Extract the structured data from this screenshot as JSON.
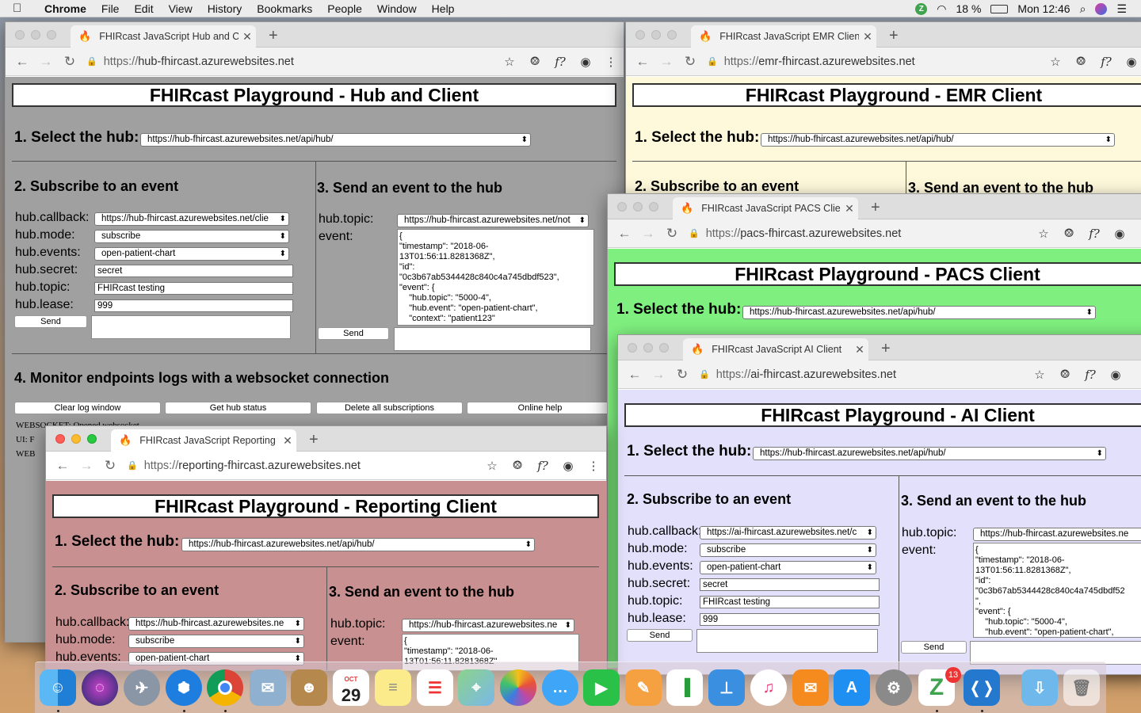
{
  "menubar": {
    "app": "Chrome",
    "items": [
      "File",
      "Edit",
      "View",
      "History",
      "Bookmarks",
      "People",
      "Window",
      "Help"
    ],
    "battery": "18 %",
    "clock": "Mon 12:46",
    "z": "Z"
  },
  "common": {
    "select_hub": "1. Select the hub:",
    "hub_url": "https://hub-fhircast.azurewebsites.net/api/hub/",
    "subscribe_title": "2. Subscribe to an event",
    "send_title": "3. Send an event to the hub",
    "monitor_title": "4. Monitor endpoints logs with a websocket connection",
    "labels": {
      "callback": "hub.callback:",
      "mode": "hub.mode:",
      "events": "hub.events:",
      "secret": "hub.secret:",
      "topic": "hub.topic:",
      "lease": "hub.lease:",
      "event": "event:"
    },
    "mode": "subscribe",
    "events": "open-patient-chart",
    "secret": "secret",
    "topic_val": "FHIRcast testing",
    "lease": "999",
    "send": "Send",
    "event_json": "{\n\"timestamp\": \"2018-06-\n13T01:56:11.8281368Z\",\n\"id\":\n\"0c3b67ab5344428c840c4a745dbdf523\",\n\"event\": {\n    \"hub.topic\": \"5000-4\",\n    \"hub.event\": \"open-patient-chart\",\n    \"context\": \"patient123\""
  },
  "hub": {
    "tab": "FHIRcast JavaScript Hub and C",
    "url_pre": "https://",
    "url": "hub-fhircast.azurewebsites.net",
    "title": "FHIRcast Playground - Hub and Client",
    "callback": "https://hub-fhircast.azurewebsites.net/clie",
    "send_topic": "https://hub-fhircast.azurewebsites.net/not",
    "buttons": [
      "Clear log window",
      "Get hub status",
      "Delete all subscriptions",
      "Online help"
    ],
    "logs": [
      "WEBSOCKET: Opened websocket",
      "UI: F",
      "WEB"
    ]
  },
  "emr": {
    "tab": "FHIRcast JavaScript EMR Clien",
    "url_pre": "https://",
    "url": "emr-fhircast.azurewebsites.net",
    "title": "FHIRcast Playground - EMR Client"
  },
  "pacs": {
    "tab": "FHIRcast JavaScript PACS Clie",
    "url_pre": "https://",
    "url": "pacs-fhircast.azurewebsites.net",
    "title": "FHIRcast Playground - PACS Client"
  },
  "ai": {
    "tab": "FHIRcast JavaScript AI Client",
    "url_pre": "https://",
    "url": "ai-fhircast.azurewebsites.net",
    "title": "FHIRcast Playground - AI Client",
    "callback": "https://ai-fhircast.azurewebsites.net/c",
    "send_topic": "https://hub-fhircast.azurewebsites.ne",
    "event_json": "{\n\"timestamp\": \"2018-06-\n13T01:56:11.8281368Z\",\n\"id\":\n\"0c3b67ab5344428c840c4a745dbdf52\n\",\n\"event\": {\n    \"hub.topic\": \"5000-4\",\n    \"hub.event\": \"open-patient-chart\","
  },
  "reporting": {
    "tab": "FHIRcast JavaScript Reporting",
    "url_pre": "https://",
    "url": "reporting-fhircast.azurewebsites.net",
    "title": "FHIRcast Playground - Reporting Client",
    "callback": "https://hub-fhircast.azurewebsites.ne",
    "send_topic": "https://hub-fhircast.azurewebsites.ne",
    "event_json": "{\n\"timestamp\": \"2018-06-\n13T01:56:11.8281368Z\""
  },
  "dock": {
    "calendar_month": "OCT",
    "calendar_day": "29",
    "badge": "13"
  },
  "colors": {
    "hub": "#a0a0a0",
    "emr": "#fff9dc",
    "pacs": "#7ff07f",
    "ai": "#e3e0fb",
    "reporting": "#c89090"
  }
}
